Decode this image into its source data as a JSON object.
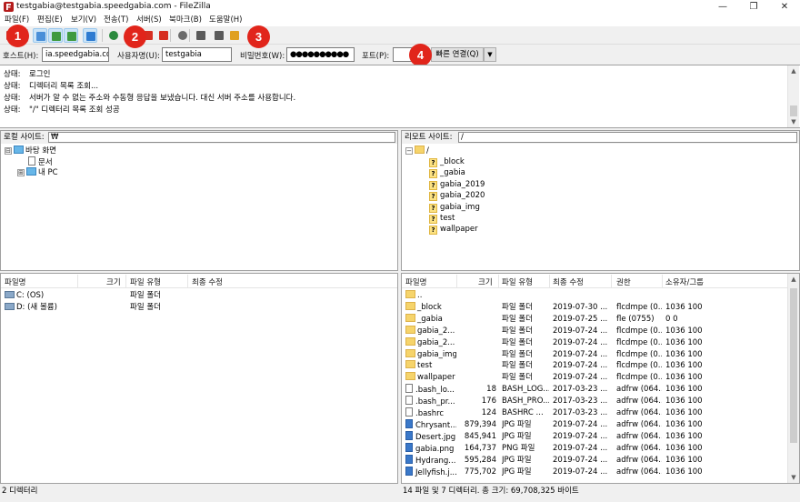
{
  "window": {
    "title": "testgabia@testgabia.speedgabia.com - FileZilla",
    "controls": {
      "minimize": "—",
      "maximize": "❐",
      "close": "✕"
    }
  },
  "menu": [
    "파일(F)",
    "편집(E)",
    "보기(V)",
    "전송(T)",
    "서버(S)",
    "북마크(B)",
    "도움말(H)"
  ],
  "toolbar": {
    "buttons": [
      {
        "name": "site-manager-button",
        "icon": "site-manager-icon",
        "color": "#c0392b"
      },
      {
        "name": "toggle-log-button",
        "icon": "message-log-icon",
        "color": "#4a8fd8",
        "pressed": true
      },
      {
        "name": "toggle-local-tree-button",
        "icon": "local-tree-icon",
        "color": "#3f9a3f",
        "pressed": true
      },
      {
        "name": "toggle-remote-tree-button",
        "icon": "remote-tree-icon",
        "color": "#3f9a3f",
        "pressed": true
      },
      {
        "name": "toggle-queue-button",
        "icon": "transfer-queue-icon",
        "color": "#2e7bd1",
        "pressed": true
      },
      {
        "name": "refresh-button",
        "icon": "refresh-icon",
        "color": "#2b8a3e"
      },
      {
        "name": "process-queue-button",
        "icon": "process-queue-icon",
        "color": "#555555"
      },
      {
        "name": "cancel-button",
        "icon": "cancel-icon",
        "color": "#d62d20"
      },
      {
        "name": "disconnect-button",
        "icon": "disconnect-icon",
        "color": "#d62d20"
      },
      {
        "name": "reconnect-button",
        "icon": "reconnect-icon",
        "color": "#6b6b6b"
      },
      {
        "name": "filter-button",
        "icon": "filter-icon",
        "color": "#5a5a5a"
      },
      {
        "name": "sync-browse-button",
        "icon": "search-icon",
        "color": "#5a5a5a"
      },
      {
        "name": "compare-button",
        "icon": "compare-icon",
        "color": "#e0a020"
      }
    ]
  },
  "quickconnect": {
    "host_label": "호스트(H):",
    "host_value": "ia.speedgabia.com",
    "user_label": "사용자명(U):",
    "user_value": "testgabia",
    "pass_label": "비밀번호(W):",
    "pass_value": "●●●●●●●●●●",
    "port_label": "포트(P):",
    "port_value": "",
    "connect_label": "빠른 연결(Q)",
    "dropdown_label": "▼"
  },
  "badges": [
    "1",
    "2",
    "3",
    "4"
  ],
  "log": [
    {
      "key": "상태:",
      "text": "로그인"
    },
    {
      "key": "상태:",
      "text": "디렉터리 목록 조회..."
    },
    {
      "key": "상태:",
      "text": "서버가 알 수 없는 주소와 수동형 응답을 보냈습니다. 대신 서버 주소를 사용합니다."
    },
    {
      "key": "상태:",
      "text": "\"/\" 디렉터리 목록 조회 성공"
    }
  ],
  "local": {
    "site_label": "로컬 사이트:",
    "site_value": "₩",
    "tree": [
      {
        "expander": "⊟",
        "icon": "desktop",
        "label": "바탕 화면"
      },
      {
        "expander": "",
        "icon": "doc",
        "label": "문서"
      },
      {
        "expander": "⊞",
        "icon": "pc",
        "label": "내 PC"
      }
    ],
    "columns": [
      "파일명",
      "크기",
      "파일 유형",
      "최종 수정"
    ],
    "files": [
      {
        "icon": "drive",
        "name": "C: (OS)",
        "size": "",
        "type": "파일 폴더",
        "modified": ""
      },
      {
        "icon": "drive",
        "name": "D: (새 볼륨)",
        "size": "",
        "type": "파일 폴더",
        "modified": ""
      }
    ],
    "status": "2 디렉터리"
  },
  "remote": {
    "site_label": "리모트 사이트:",
    "site_value": "/",
    "tree_root": "/",
    "tree": [
      "_block",
      "_gabia",
      "gabia_2019",
      "gabia_2020",
      "gabia_img",
      "test",
      "wallpaper"
    ],
    "columns": [
      "파일명",
      "크기",
      "파일 유형",
      "최종 수정",
      "권한",
      "소유자/그룹"
    ],
    "files": [
      {
        "icon": "folder",
        "name": "..",
        "size": "",
        "type": "",
        "modified": "",
        "perm": "",
        "owner": ""
      },
      {
        "icon": "folder",
        "name": "_block",
        "size": "",
        "type": "파일 폴더",
        "modified": "2019-07-30 ...",
        "perm": "flcdmpe (0...",
        "owner": "1036 100"
      },
      {
        "icon": "folder",
        "name": "_gabia",
        "size": "",
        "type": "파일 폴더",
        "modified": "2019-07-25 ...",
        "perm": "fle (0755)",
        "owner": "0 0"
      },
      {
        "icon": "folder",
        "name": "gabia_2...",
        "size": "",
        "type": "파일 폴더",
        "modified": "2019-07-24 ...",
        "perm": "flcdmpe (0...",
        "owner": "1036 100"
      },
      {
        "icon": "folder",
        "name": "gabia_2...",
        "size": "",
        "type": "파일 폴더",
        "modified": "2019-07-24 ...",
        "perm": "flcdmpe (0...",
        "owner": "1036 100"
      },
      {
        "icon": "folder",
        "name": "gabia_img",
        "size": "",
        "type": "파일 폴더",
        "modified": "2019-07-24 ...",
        "perm": "flcdmpe (0...",
        "owner": "1036 100"
      },
      {
        "icon": "folder",
        "name": "test",
        "size": "",
        "type": "파일 폴더",
        "modified": "2019-07-24 ...",
        "perm": "flcdmpe (0...",
        "owner": "1036 100"
      },
      {
        "icon": "folder",
        "name": "wallpaper",
        "size": "",
        "type": "파일 폴더",
        "modified": "2019-07-24 ...",
        "perm": "flcdmpe (0...",
        "owner": "1036 100"
      },
      {
        "icon": "doc",
        "name": ".bash_lo...",
        "size": "18",
        "type": "BASH_LOG...",
        "modified": "2017-03-23 ...",
        "perm": "adfrw (064...",
        "owner": "1036 100"
      },
      {
        "icon": "doc",
        "name": ".bash_pr...",
        "size": "176",
        "type": "BASH_PRO...",
        "modified": "2017-03-23 ...",
        "perm": "adfrw (064...",
        "owner": "1036 100"
      },
      {
        "icon": "doc",
        "name": ".bashrc",
        "size": "124",
        "type": "BASHRC ...",
        "modified": "2017-03-23 ...",
        "perm": "adfrw (064...",
        "owner": "1036 100"
      },
      {
        "icon": "img",
        "name": "Chrysant...",
        "size": "879,394",
        "type": "JPG 파일",
        "modified": "2019-07-24 ...",
        "perm": "adfrw (064...",
        "owner": "1036 100"
      },
      {
        "icon": "img",
        "name": "Desert.jpg",
        "size": "845,941",
        "type": "JPG 파일",
        "modified": "2019-07-24 ...",
        "perm": "adfrw (064...",
        "owner": "1036 100"
      },
      {
        "icon": "img",
        "name": "gabia.png",
        "size": "164,737",
        "type": "PNG 파일",
        "modified": "2019-07-24 ...",
        "perm": "adfrw (064...",
        "owner": "1036 100"
      },
      {
        "icon": "img",
        "name": "Hydrang...",
        "size": "595,284",
        "type": "JPG 파일",
        "modified": "2019-07-24 ...",
        "perm": "adfrw (064...",
        "owner": "1036 100"
      },
      {
        "icon": "img",
        "name": "Jellyfish.j...",
        "size": "775,702",
        "type": "JPG 파일",
        "modified": "2019-07-24 ...",
        "perm": "adfrw (064...",
        "owner": "1036 100"
      }
    ],
    "status": "14 파일 및 7 디렉터리. 총 크기: 69,708,325 바이트"
  }
}
